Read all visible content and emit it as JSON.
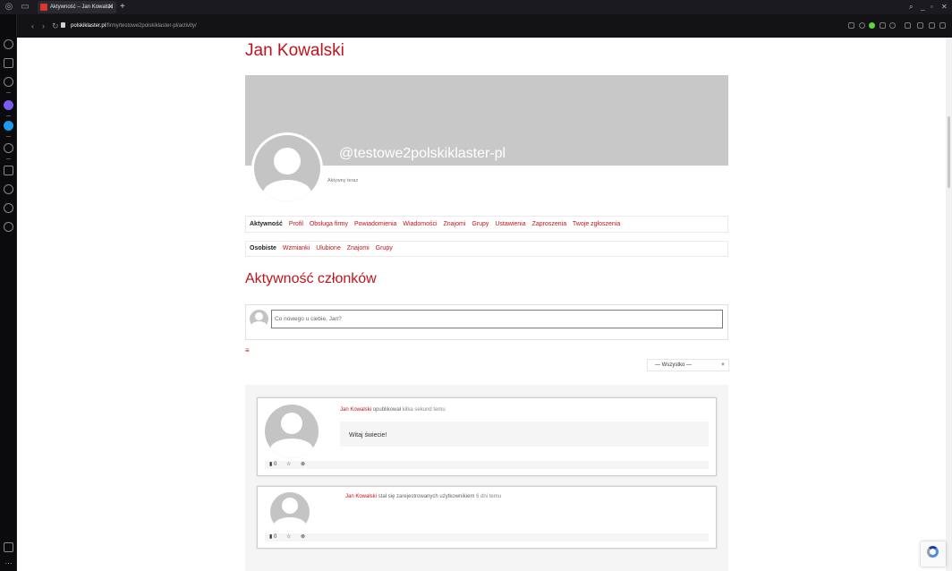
{
  "browser": {
    "tab_title": "Aktywność – Jan Kowalski",
    "tab_close": "✕",
    "new_tab": "+",
    "url_domain": "polskiklaster.pl",
    "url_path": "/firmy/testowe2polskiklaster-pl/activity/",
    "back": "‹",
    "forward": "›",
    "reload": "↻",
    "search_icon": "⌕",
    "minimize": "_",
    "maximize": "▫",
    "close": "✕"
  },
  "sidebar": {
    "icons": [
      "speed-dial-icon",
      "bag-icon",
      "extension-icon",
      "messenger-icon",
      "twitter-icon",
      "player-icon",
      "edit-icon",
      "history-icon",
      "box-icon",
      "settings-icon",
      "pinboard-icon",
      "more-icon"
    ]
  },
  "profile": {
    "name": "Jan Kowalski",
    "handle": "@testowe2polskiklaster-pl",
    "status": "Aktywny teraz"
  },
  "nav_primary": [
    "Aktywność",
    "Profil",
    "Obsługa firmy",
    "Powiadomienia",
    "Wiadomości",
    "Znajomi",
    "Grupy",
    "Ustawienia",
    "Zaproszenia",
    "Twoje zgłoszenia"
  ],
  "nav_secondary": [
    "Osobiste",
    "Wzmianki",
    "Ulubione",
    "Znajomi",
    "Grupy"
  ],
  "activity": {
    "heading": "Aktywność członków",
    "post_placeholder": "Co nowego u ciebie, Jan?",
    "rss": "…",
    "filter_value": "— Wszystko —",
    "filter_caret": "▼"
  },
  "feed": [
    {
      "author": "Jan Kowalski",
      "action": "opublikował",
      "time": "kilka sekund temu",
      "content": "Witaj świecie!",
      "comments": "0"
    },
    {
      "author": "Jan Kowalski",
      "action": "stał się zarejestrowanych użytkownikiem",
      "time": "6 dni temu",
      "content": "",
      "comments": "0"
    }
  ],
  "colors": {
    "accent": "#c0141c",
    "cover": "#c8c8c8",
    "browser_bg": "#1b1b1f"
  }
}
